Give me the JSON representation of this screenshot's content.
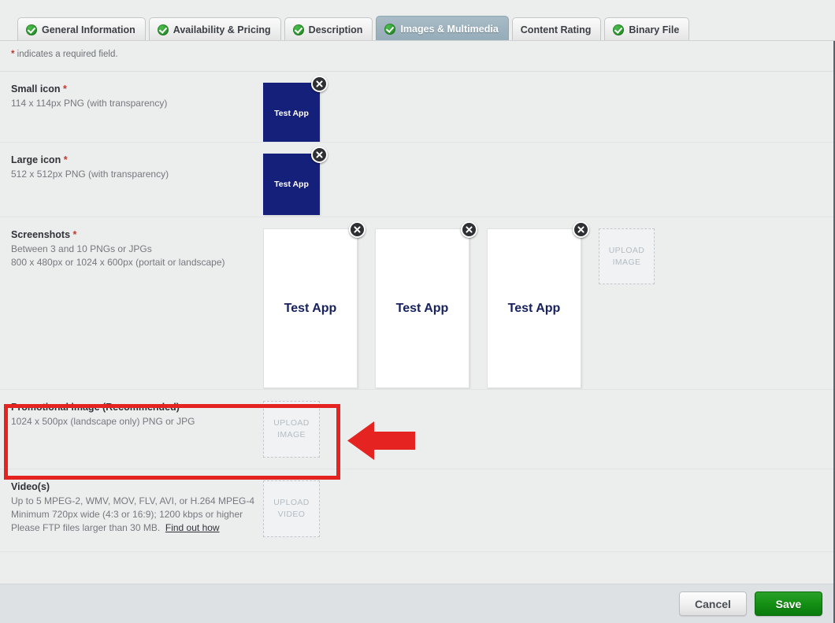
{
  "tabs": [
    {
      "label": "General Information",
      "checked": true,
      "active": false
    },
    {
      "label": "Availability & Pricing",
      "checked": true,
      "active": false
    },
    {
      "label": "Description",
      "checked": true,
      "active": false
    },
    {
      "label": "Images & Multimedia",
      "checked": true,
      "active": true
    },
    {
      "label": "Content Rating",
      "checked": false,
      "active": false
    },
    {
      "label": "Binary File",
      "checked": true,
      "active": false
    }
  ],
  "required_note": {
    "star": "*",
    "text": " indicates a required field."
  },
  "rows": {
    "small_icon": {
      "title": "Small icon",
      "required": "*",
      "sub1": "114 x 114px PNG (with transparency)",
      "thumb_label": "Test App"
    },
    "large_icon": {
      "title": "Large icon",
      "required": "*",
      "sub1": "512 x 512px PNG (with transparency)",
      "thumb_label": "Test App"
    },
    "screenshots": {
      "title": "Screenshots",
      "required": "*",
      "sub1": "Between 3 and 10 PNGs or JPGs",
      "sub2": "800 x 480px or 1024 x 600px (portait or landscape)",
      "items": [
        {
          "label": "Test App"
        },
        {
          "label": "Test App"
        },
        {
          "label": "Test App"
        }
      ],
      "upload_line1": "UPLOAD",
      "upload_line2": "IMAGE"
    },
    "promotional": {
      "title": "Promotional image (Recommended)",
      "sub1": "1024 x 500px (landscape only) PNG or JPG",
      "upload_line1": "UPLOAD",
      "upload_line2": "IMAGE"
    },
    "videos": {
      "title": "Video(s)",
      "sub1": "Up to 5 MPEG-2, WMV, MOV, FLV, AVI, or H.264 MPEG-4",
      "sub2": "Minimum 720px wide (4:3 or 16:9); 1200 kbps or higher",
      "sub3": "Please FTP files larger than 30 MB.",
      "link": "Find out how",
      "upload_line1": "UPLOAD",
      "upload_line2": "VIDEO"
    }
  },
  "footer": {
    "cancel_label": "Cancel",
    "save_label": "Save"
  },
  "annotation": {
    "highlight_color": "#e52421",
    "arrow_color": "#e52421",
    "arrow_direction": "left"
  },
  "colors": {
    "page_background": "#eceded",
    "active_tab": "#9db2be",
    "icon_thumb": "#14207a",
    "screenshot_text": "#17215e",
    "save_button": "#149014",
    "required_star": "#c0392b",
    "footer_bar": "#dde1e4"
  }
}
